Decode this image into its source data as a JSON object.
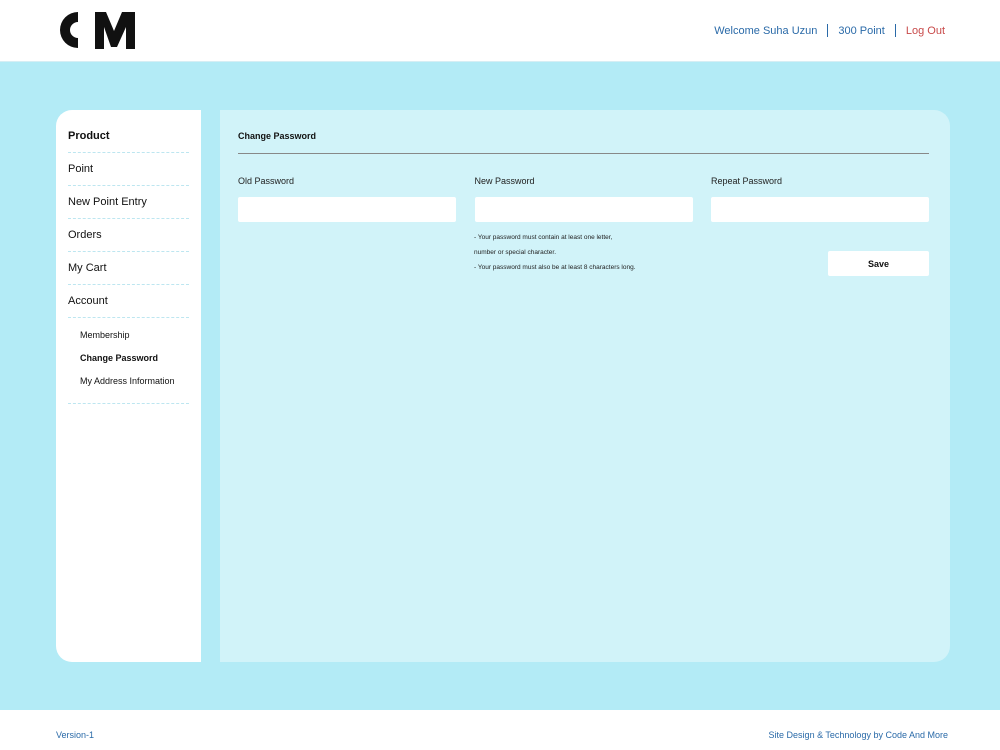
{
  "header": {
    "logo_text": "CM",
    "welcome": "Welcome Suha Uzun",
    "points": "300 Point",
    "logout": "Log Out"
  },
  "sidebar": {
    "items": [
      {
        "label": "Product"
      },
      {
        "label": "Point"
      },
      {
        "label": "New Point Entry"
      },
      {
        "label": "Orders"
      },
      {
        "label": "My Cart"
      },
      {
        "label": "Account"
      }
    ],
    "account_sub": [
      {
        "label": "Membership"
      },
      {
        "label": "Change Password"
      },
      {
        "label": "My Address Information"
      }
    ]
  },
  "main": {
    "title": "Change Password",
    "fields": {
      "old_label": "Old Password",
      "old_value": "",
      "new_label": "New Password",
      "new_value": "",
      "repeat_label": "Repeat Password",
      "repeat_value": ""
    },
    "hints": [
      "- Your password must contain at least one letter,",
      "number or special character.",
      "- Your password must also be at least 8 characters long."
    ],
    "save_label": "Save"
  },
  "footer": {
    "version": "Version-1",
    "credit": "Site Design & Technology by Code And More"
  },
  "colors": {
    "page_bg": "#b3ebf6",
    "content_bg": "#d1f3f9",
    "link": "#2a6aa8",
    "logout": "#c84a4a"
  }
}
